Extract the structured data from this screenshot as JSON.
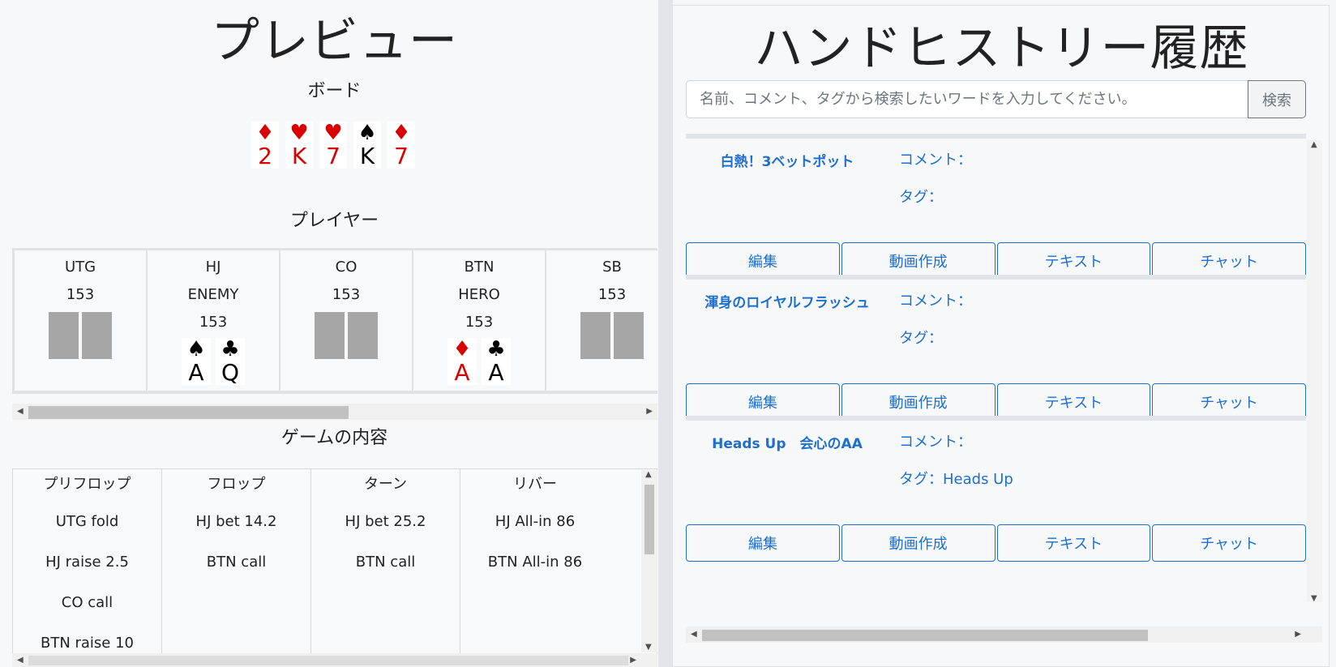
{
  "preview": {
    "title": "プレビュー",
    "board_title": "ボード",
    "board": [
      {
        "suit": "♦",
        "rank": "2",
        "color": "#d90000"
      },
      {
        "suit": "♥",
        "rank": "K",
        "color": "#d90000"
      },
      {
        "suit": "♥",
        "rank": "7",
        "color": "#d90000"
      },
      {
        "suit": "♠",
        "rank": "K",
        "color": "#000000"
      },
      {
        "suit": "♦",
        "rank": "7",
        "color": "#d90000"
      }
    ],
    "players_title": "プレイヤー",
    "players": [
      {
        "pos": "UTG",
        "name": "",
        "stack": "153",
        "cards": "hidden"
      },
      {
        "pos": "HJ",
        "name": "ENEMY",
        "stack": "153",
        "cards": [
          {
            "suit": "♠",
            "rank": "A"
          },
          {
            "suit": "♣",
            "rank": "Q"
          }
        ]
      },
      {
        "pos": "CO",
        "name": "",
        "stack": "153",
        "cards": "hidden"
      },
      {
        "pos": "BTN",
        "name": "HERO",
        "stack": "153",
        "cards": [
          {
            "suit": "♦",
            "rank": "A"
          },
          {
            "suit": "♣",
            "rank": "A"
          }
        ]
      },
      {
        "pos": "SB",
        "name": "",
        "stack": "153",
        "cards": "hidden"
      }
    ],
    "game_title": "ゲームの内容",
    "streets": [
      {
        "label": "プリフロップ",
        "actions": [
          "UTG fold",
          "HJ raise 2.5",
          "CO call",
          "BTN raise 10"
        ]
      },
      {
        "label": "フロップ",
        "actions": [
          "HJ bet 14.2",
          "BTN call"
        ]
      },
      {
        "label": "ターン",
        "actions": [
          "HJ bet 25.2",
          "BTN call"
        ]
      },
      {
        "label": "リバー",
        "actions": [
          "HJ All-in 86",
          "BTN All-in 86"
        ]
      }
    ]
  },
  "history": {
    "title": "ハンドヒストリー履歴",
    "search_placeholder": "名前、コメント、タグから検索したいワードを入力してください。",
    "search_button": "検索",
    "entries": [
      {
        "name": "白熱！3ベットポット",
        "comment": "コメント：",
        "tag": "タグ："
      },
      {
        "name": "渾身のロイヤルフラッシュ",
        "comment": "コメント：",
        "tag": "タグ："
      },
      {
        "name": "Heads Up　会心のAA",
        "comment": "コメント：",
        "tag": "タグ：Heads Up"
      }
    ],
    "buttons": [
      "編集",
      "動画作成",
      "テキスト",
      "チャット"
    ]
  },
  "colors": {
    "accent": "#1e6fd0",
    "red_suit": "#d90000",
    "card_back": "#a6a6a6"
  }
}
